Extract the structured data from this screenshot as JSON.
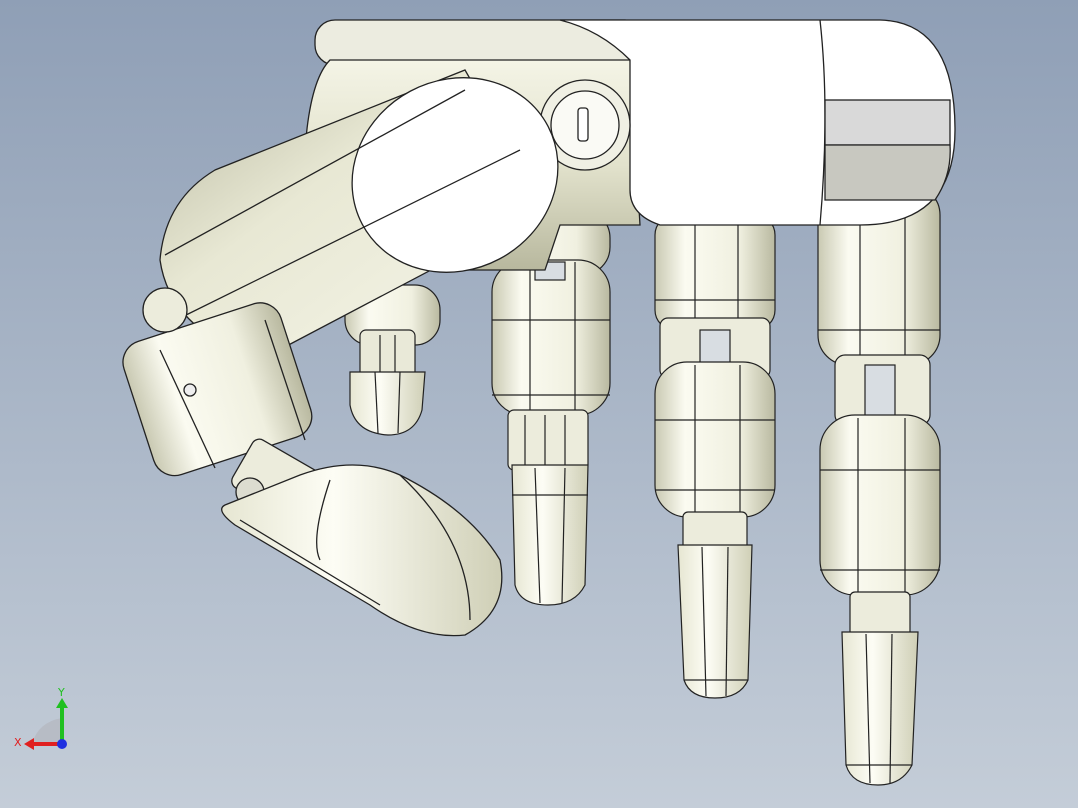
{
  "viewport": {
    "background_top": "#8f9fb6",
    "background_bottom": "#c4cdd8"
  },
  "model": {
    "shade_light": "#fbfbf1",
    "shade_mid": "#e6e6cf",
    "shade_dark": "#a9a990",
    "edge_color": "#222222"
  },
  "triad": {
    "x_label": "X",
    "y_label": "Y",
    "x_color": "#e02020",
    "y_color": "#20c020",
    "z_color": "#2030e0"
  }
}
